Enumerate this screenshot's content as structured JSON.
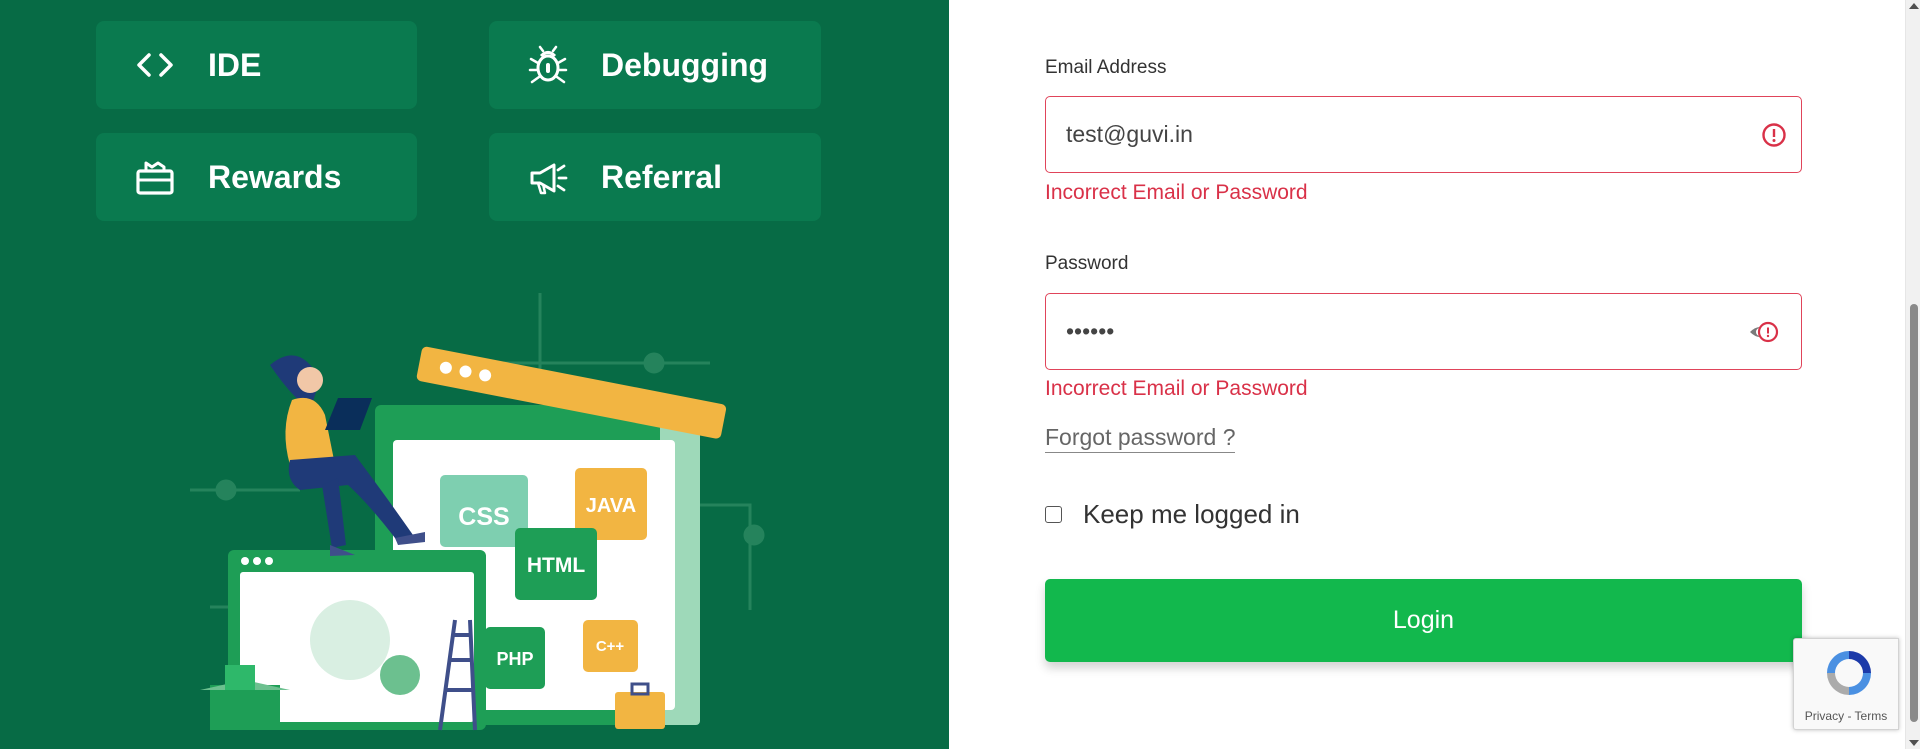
{
  "features": [
    {
      "label": "IDE",
      "icon": "code-icon"
    },
    {
      "label": "Debugging",
      "icon": "bug-icon"
    },
    {
      "label": "Rewards",
      "icon": "gift-icon"
    },
    {
      "label": "Referral",
      "icon": "megaphone-icon"
    }
  ],
  "illustration": {
    "tags": [
      "CSS",
      "JAVA",
      "HTML",
      "PHP",
      "C++"
    ]
  },
  "form": {
    "email_label": "Email Address",
    "email_value": "test@guvi.in",
    "email_error": "Incorrect Email or Password",
    "password_label": "Password",
    "password_value": "••••••",
    "password_error": "Incorrect Email or Password",
    "forgot_label": "Forgot password ?",
    "keep_logged_label": "Keep me logged in",
    "keep_logged_checked": false,
    "login_label": "Login"
  },
  "recaptcha": {
    "links": "Privacy - Terms"
  },
  "colors": {
    "panel_green": "#076b45",
    "card_green": "#0a7a4f",
    "error_red": "#d93148",
    "login_green": "#12b84d"
  }
}
